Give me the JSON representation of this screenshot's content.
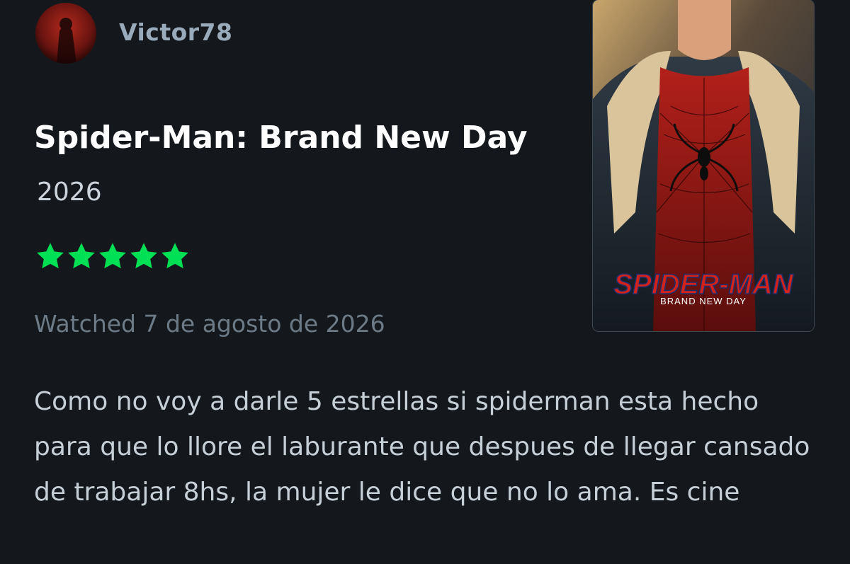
{
  "review": {
    "username": "Victor78",
    "film_title": "Spider-Man: Brand New Day",
    "film_year": "2026",
    "rating": {
      "stars": 5,
      "max": 5
    },
    "star_color": "#00e054",
    "watched_label": "Watched 7 de agosto de 2026",
    "body": "Como no voy a darle 5 estrellas si spiderman esta hecho para que lo llore el laburante que despues de llegar cansado de trabajar 8hs, la mujer le dice que no lo ama. Es cine"
  },
  "poster": {
    "logo_text": "SPIDER-MAN",
    "subtitle_text": "BRAND NEW DAY"
  }
}
